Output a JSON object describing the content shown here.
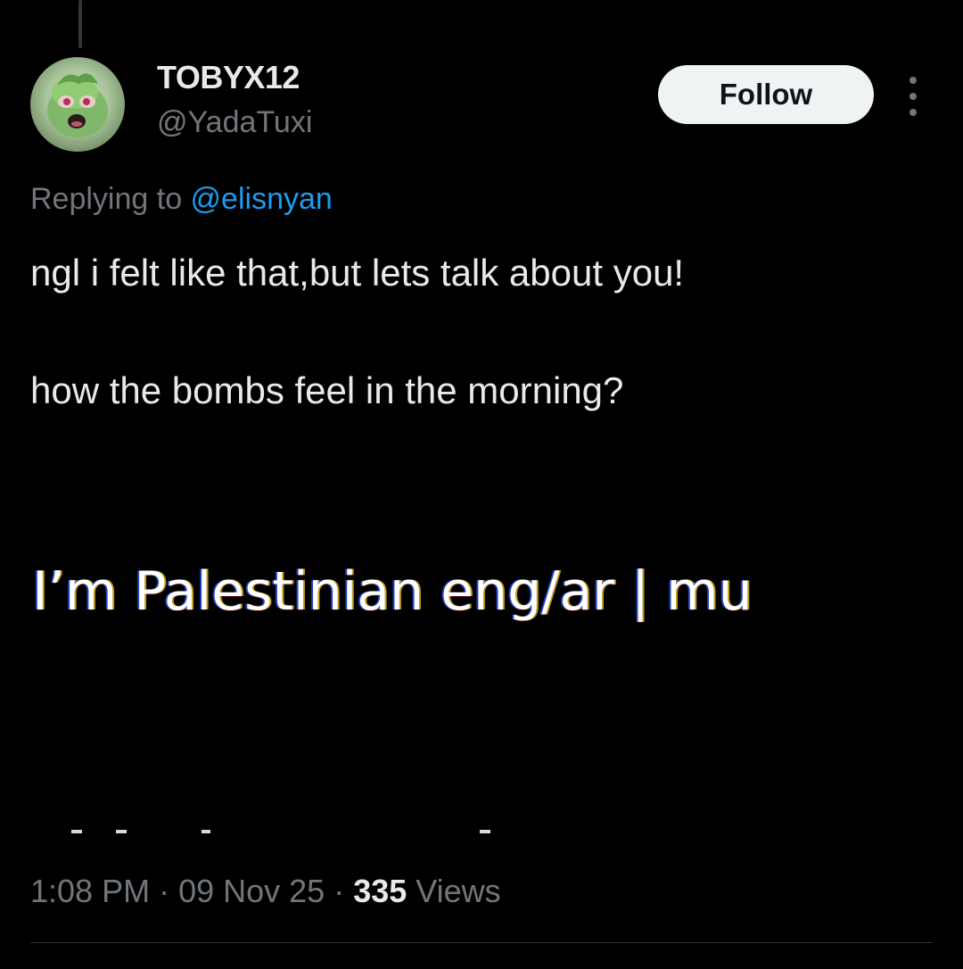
{
  "author": {
    "display_name": "TOBYX12",
    "handle": "@YadaTuxi",
    "avatar_icon": "green-cartoon-character-avatar"
  },
  "actions": {
    "follow_label": "Follow",
    "more_icon": "more-vertical-icon"
  },
  "reply": {
    "prefix": "Replying to ",
    "mention": "@elisnyan"
  },
  "tweet": {
    "line1": "ngl i felt like that,but lets talk about you!",
    "line2": "how the bombs feel in the morning?"
  },
  "embedded_image": {
    "text": "I’m Palestinian eng/ar | mu"
  },
  "meta": {
    "time": "1:08 PM",
    "sep1": " · ",
    "date": "09 Nov 25",
    "sep2": " · ",
    "views_count": "335",
    "views_label": " Views"
  },
  "colors": {
    "background": "#000000",
    "primary_text": "#e7e9ea",
    "secondary_text": "#71767b",
    "link": "#1d9bf0",
    "follow_bg": "#eff3f4"
  }
}
